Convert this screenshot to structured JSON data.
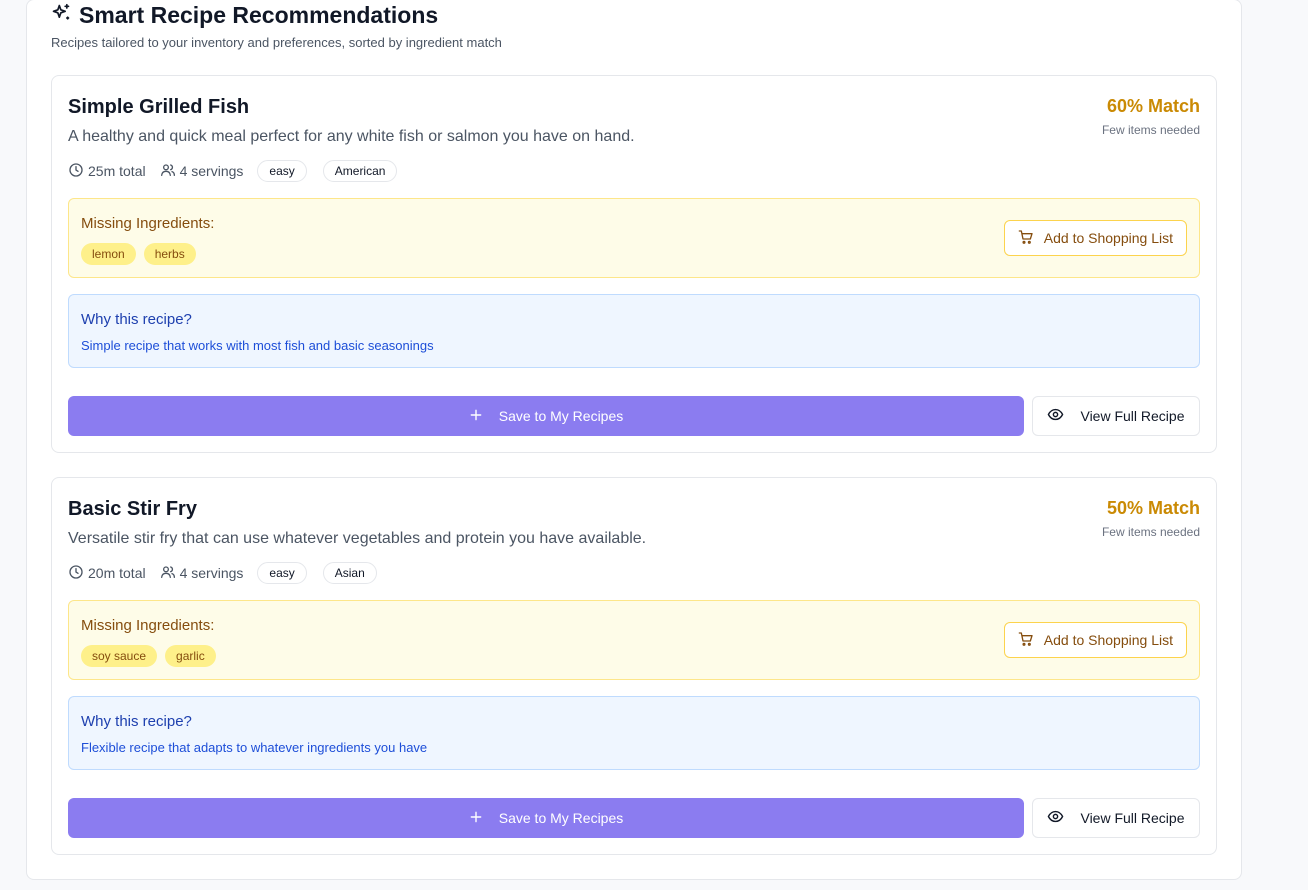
{
  "header": {
    "title": "Smart Recipe Recommendations",
    "subtitle": "Recipes tailored to your inventory and preferences, sorted by ingredient match"
  },
  "recipes": [
    {
      "title": "Simple Grilled Fish",
      "description": "A healthy and quick meal perfect for any white fish or salmon you have on hand.",
      "match": "60% Match",
      "match_note": "Few items needed",
      "time": "25m total",
      "servings": "4 servings",
      "difficulty": "easy",
      "cuisine": "American",
      "missing_title": "Missing Ingredients:",
      "missing": [
        "lemon",
        "herbs"
      ],
      "shopping_label": "Add to Shopping List",
      "why_title": "Why this recipe?",
      "why_text": "Simple recipe that works with most fish and basic seasonings",
      "save_label": "Save to My Recipes",
      "view_label": "View Full Recipe"
    },
    {
      "title": "Basic Stir Fry",
      "description": "Versatile stir fry that can use whatever vegetables and protein you have available.",
      "match": "50% Match",
      "match_note": "Few items needed",
      "time": "20m total",
      "servings": "4 servings",
      "difficulty": "easy",
      "cuisine": "Asian",
      "missing_title": "Missing Ingredients:",
      "missing": [
        "soy sauce",
        "garlic"
      ],
      "shopping_label": "Add to Shopping List",
      "why_title": "Why this recipe?",
      "why_text": "Flexible recipe that adapts to whatever ingredients you have",
      "save_label": "Save to My Recipes",
      "view_label": "View Full Recipe"
    }
  ],
  "icons": {
    "title": "sparkles-icon",
    "time": "clock-icon",
    "servings": "users-icon",
    "shopping": "cart-icon",
    "save": "plus-icon",
    "view": "eye-icon"
  },
  "colors": {
    "match": "#ca8a04",
    "primary_button": "#8b7cf0",
    "missing_bg": "#fefce8",
    "why_bg": "#eff6ff"
  }
}
